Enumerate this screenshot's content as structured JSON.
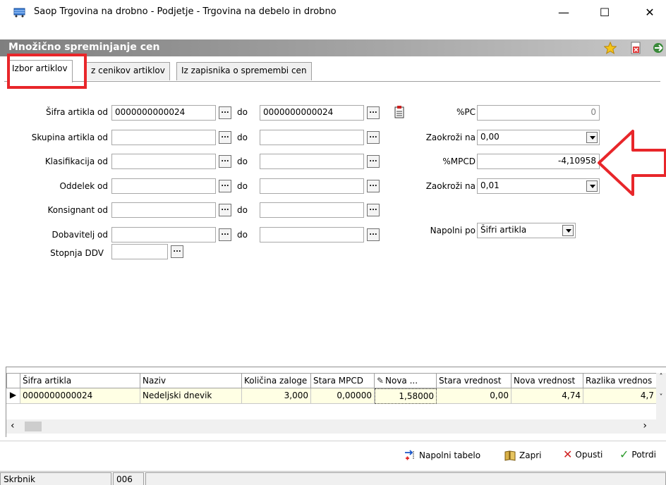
{
  "window": {
    "title": "Saop Trgovina na drobno - Podjetje - Trgovina na debelo in drobno",
    "minimize": "—",
    "maximize": "☐",
    "close": "✕"
  },
  "header": {
    "title": "Množično spreminjanje cen",
    "icons": [
      "star-icon",
      "delete-document-icon",
      "exit-icon"
    ]
  },
  "tabs": [
    {
      "label": "Izbor artiklov",
      "active": true
    },
    {
      "label": "z cenikov artiklov",
      "active": false
    },
    {
      "label": "Iz zapisnika o spremembi cen",
      "active": false
    }
  ],
  "form": {
    "rows": [
      {
        "label": "Šifra artikla od",
        "from": "0000000000024",
        "to_label": "do",
        "to": "0000000000024"
      },
      {
        "label": "Skupina artikla od",
        "from": "",
        "to_label": "do",
        "to": ""
      },
      {
        "label": "Klasifikacija od",
        "from": "",
        "to_label": "do",
        "to": ""
      },
      {
        "label": "Oddelek od",
        "from": "",
        "to_label": "do",
        "to": ""
      },
      {
        "label": "Konsignant od",
        "from": "",
        "to_label": "do",
        "to": ""
      },
      {
        "label": "Dobavitelj od",
        "from": "",
        "to_label": "do",
        "to": ""
      }
    ],
    "stopnja_ddv": {
      "label": "Stopnja DDV",
      "value": ""
    },
    "dots": "...",
    "pc": {
      "label": "%PC",
      "value": "0"
    },
    "zaokrozi1": {
      "label": "Zaokroži na",
      "value": "0,00"
    },
    "mpcd": {
      "label": "%MPCD",
      "value": "-4,10958"
    },
    "zaokrozi2": {
      "label": "Zaokroži na",
      "value": "0,01"
    },
    "napolni_po": {
      "label": "Napolni po",
      "value": "Šifri artikla"
    }
  },
  "grid": {
    "columns": [
      "Šifra artikla",
      "Naziv",
      "Količina zaloge",
      "Stara MPCD",
      "Nova ...",
      "Stara vrednost",
      "Nova vrednost",
      "Razlika vrednos"
    ],
    "rows": [
      [
        "0000000000024",
        "Nedeljski dnevik",
        "3,000",
        "0,00000",
        "1,58000",
        "0,00",
        "4,74",
        "4,7"
      ]
    ]
  },
  "toolbar": {
    "napolni": "Napolni tabelo",
    "zapri": "Zapri",
    "opusti": "Opusti",
    "potrdi": "Potrdi"
  },
  "status": {
    "user": "Skrbnik",
    "code": "006"
  },
  "colors": {
    "highlight": "#e8262a",
    "row_background": "#ffffe4",
    "header_gradient_start": "#7f7f7f"
  }
}
